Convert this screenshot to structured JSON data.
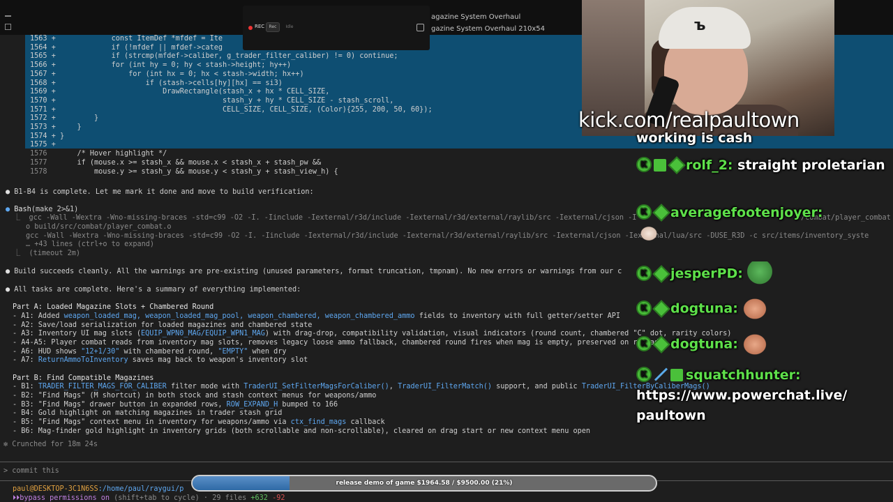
{
  "window": {
    "title_line1": "agazine System Overhaul",
    "title_line2": "gazine System Overhaul 210x54"
  },
  "recorder": {
    "rec_label": "REC",
    "pill_rec": "Rec",
    "pill_idle": "Idle"
  },
  "diff_lines": [
    {
      "num": "1563",
      "sign": "+",
      "code": "            const ItemDef *mfdef = Ite"
    },
    {
      "num": "1564",
      "sign": "+",
      "code": "            if (!mfdef || mfdef->categ"
    },
    {
      "num": "1565",
      "sign": "+",
      "code": "            if (strcmp(mfdef->caliber, g_trader_filter_caliber) != 0) continue;"
    },
    {
      "num": "1566",
      "sign": "+",
      "code": "            for (int hy = 0; hy < stash->height; hy++)"
    },
    {
      "num": "1567",
      "sign": "+",
      "code": "                for (int hx = 0; hx < stash->width; hx++)"
    },
    {
      "num": "1568",
      "sign": "+",
      "code": "                    if (stash->cells[hy][hx] == si3)"
    },
    {
      "num": "1569",
      "sign": "+",
      "code": "                        DrawRectangle(stash_x + hx * CELL_SIZE,"
    },
    {
      "num": "1570",
      "sign": "+",
      "code": "                                      stash_y + hy * CELL_SIZE - stash_scroll,"
    },
    {
      "num": "1571",
      "sign": "+",
      "code": "                                      CELL_SIZE, CELL_SIZE, (Color){255, 200, 50, 60});"
    },
    {
      "num": "1572",
      "sign": "+",
      "code": "        }"
    },
    {
      "num": "1573",
      "sign": "+",
      "code": "    }"
    },
    {
      "num": "1574",
      "sign": "+",
      "code": "}"
    },
    {
      "num": "1575",
      "sign": "+",
      "code": ""
    }
  ],
  "context_lines": [
    {
      "num": "1576",
      "code": "    /* Hover highlight */"
    },
    {
      "num": "1577",
      "code": "    if (mouse.x >= stash_x && mouse.x < stash_x + stash_pw &&"
    },
    {
      "num": "1578",
      "code": "        mouse.y >= stash_y && mouse.y < stash_y + stash_view_h) {"
    }
  ],
  "messages": {
    "b1b4": "B1-B4 is complete. Let me mark it done and move to build verification:",
    "bash_title": "Bash",
    "bash_args": "(make 2>&1)",
    "bash_out1": "gcc -Wall -Wextra -Wno-missing-braces -std=c99 -O2 -I. -Iinclude -Iexternal/r3d/include -Iexternal/r3d/external/raylib/src -Iexternal/cjson -I",
    "bash_out1_tail": "/combat/player_combat",
    "bash_out2": "o build/src/combat/player_combat.o",
    "bash_out3": "gcc -Wall -Wextra -Wno-missing-braces -std=c99 -O2 -I. -Iinclude -Iexternal/r3d/include -Iexternal/r3d/external/raylib/src -Iexternal/cjson -Iexternal/lua/src -DUSE_R3D -c src/items/inventory_syste",
    "bash_more": "… +43 lines (ctrl+o to expand)",
    "bash_timeout": "(timeout 2m)",
    "build_ok": "Build succeeds cleanly. All the warnings are pre-existing (unused parameters, format truncation, tmpnam). No new errors or warnings from our c",
    "all_done": "All tasks are complete. Here's a summary of everything implemented:",
    "part_a": "Part A: Loaded Magazine Slots + Chambered Round",
    "a1_pre": "- A1: Added ",
    "a1_code": "weapon_loaded_mag, weapon_loaded_mag_pool, weapon_chambered, weapon_chambered_ammo",
    "a1_post": " fields to inventory with full getter/setter API",
    "a2": "- A2: Save/load serialization for loaded magazines and chambered state",
    "a3_pre": "- A3: Inventory UI mag slots (",
    "a3_code": "EQUIP_WPN0_MAG/EQUIP_WPN1_MAG",
    "a3_post": ") with drag-drop, compatibility validation, visual indicators (round count, chambered \"C\" dot, rarity colors)",
    "a45": "- A4-A5: Player combat reads from inventory mag slots, removes legacy loose ammo fallback, chambered round fires when mag is empty, preserved on reload",
    "a6_pre": "- A6: HUD shows ",
    "a6_code1": "\"12+1/30\"",
    "a6_mid": " with chambered round, ",
    "a6_code2": "\"EMPTY\"",
    "a6_post": " when dry",
    "a7_pre": "- A7: ",
    "a7_code": "ReturnAmmoToInventory",
    "a7_post": " saves mag back to weapon's inventory slot",
    "part_b": "Part B: Find Compatible Magazines",
    "b1_pre": "- B1: ",
    "b1_code1": "TRADER_FILTER_MAGS_FOR_CALIBER",
    "b1_mid1": " filter mode with ",
    "b1_code2": "TraderUI_SetFilterMagsForCaliber()",
    "b1_mid2": ", ",
    "b1_code3": "TraderUI_FilterMatch()",
    "b1_mid3": " support, and public ",
    "b1_code4": "TraderUI_FilterByCaliberMags()",
    "b2": "- B2: \"Find Mags\" (M shortcut) in both stock and stash context menus for weapons/ammo",
    "b3_pre": "- B3: \"Find Mags\" drawer button in expanded rows, ",
    "b3_code": "ROW_EXPAND_H",
    "b3_post": " bumped to 166",
    "b4": "- B4: Gold highlight on matching magazines in trader stash grid",
    "b5_pre": "- B5: \"Find Mags\" context menu in inventory for weapons/ammo via ",
    "b5_code": "ctx_find_mags",
    "b5_post": " callback",
    "b6": "- B6: Mag-finder gold highlight in inventory grids (both scrollable and non-scrollable), cleared on drag start or new context menu open",
    "crunched": "Crunched for 18m 24s"
  },
  "input": {
    "prompt_symbol": ">",
    "text": "commit this"
  },
  "status": {
    "user_host": "paul@DESKTOP-3C1N6SS",
    "path": ":/home/paul/raygui/p",
    "bypass": "bypass permissions on",
    "cycle": " (shift+tab to cycle) · 29 files ",
    "added": "+632",
    "removed": "-92"
  },
  "progress": {
    "label": "release demo of game $1964.58 / $9500.00 (21%)",
    "fraction": 0.21
  },
  "stream": {
    "watermark": "kick.com/realpaultown",
    "cap_logo": "ъ"
  },
  "chat": [
    {
      "user": "",
      "text": "working is cash"
    },
    {
      "user": "rolf_2:",
      "text": "straight proletarian"
    },
    {
      "user": "averagefootenjoyer:",
      "text": ""
    },
    {
      "user": "jesperPD:",
      "text": ""
    },
    {
      "user": "dogtuna:",
      "text": ""
    },
    {
      "user": "dogtuna:",
      "text": ""
    },
    {
      "user": "squatchhunter:",
      "text": "https://www.powerchat.live/ paultown"
    }
  ],
  "colors": {
    "diff_bg": "#0e4e72",
    "chat_user": "#5ee04a",
    "link": "#5ea7f0"
  }
}
